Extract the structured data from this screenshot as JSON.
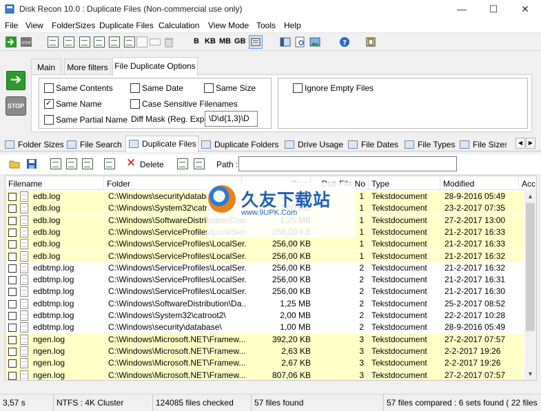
{
  "window": {
    "title": "Disk Recon 10.0 : Duplicate Files  (Non-commercial use only)",
    "controls": {
      "minimize": "—",
      "maximize": "☐",
      "close": "✕"
    }
  },
  "menu": [
    "File",
    "View",
    "FolderSizes",
    "Duplicate Files",
    "Calculation",
    "View Mode",
    "Tools",
    "Help"
  ],
  "toolbar": {
    "size_units": [
      "B",
      "KB",
      "MB",
      "GB"
    ],
    "icons": [
      "start-icon",
      "stop-icon",
      "export-excel-icon",
      "export-word-icon",
      "export-text-icon",
      "export-pdf-icon",
      "export-html-icon",
      "export-csv-icon",
      "copy-icon",
      "drive-icon",
      "recycle-bin-icon",
      "list-view-icon",
      "layout-icon",
      "find-icon",
      "image-icon",
      "help-icon",
      "info-icon"
    ]
  },
  "options": {
    "go_label": "➔",
    "stop_label": "STOP",
    "tabs": [
      "Main",
      "More filters",
      "File Duplicate Options"
    ],
    "active_tab": "File Duplicate Options",
    "checkboxes": {
      "same_contents": "Same Contents",
      "same_date": "Same Date",
      "same_size": "Same Size",
      "same_name": "Same Name",
      "case_sensitive": "Case Sensitive Filenames",
      "same_partial_name": "Same Partial Name",
      "ignore_empty": "Ignore Empty Files"
    },
    "checked": [
      "same_name"
    ],
    "diff_mask_label": "Diff Mask (Reg. Exp.)",
    "diff_mask_value": "\\D\\d{1,3}\\D"
  },
  "main_tabs": [
    "Folder Sizes",
    "File Search",
    "Duplicate Files",
    "Duplicate Folders",
    "Drive Usage",
    "File Dates",
    "File Types",
    "File Sizes"
  ],
  "active_main_tab": "Duplicate Files",
  "tab_scroll": {
    "left": "◀",
    "right": "▶"
  },
  "file_toolbar": {
    "delete_label": "Delete",
    "path_label": "Path :",
    "path_value": ""
  },
  "list": {
    "columns": [
      "Filename",
      "Folder",
      "Size",
      "Dup File No",
      "Type",
      "Modified",
      "Acc"
    ],
    "rows": [
      {
        "name": "edb.log",
        "folder": "C:\\Windows\\security\\database\\",
        "size": "1,00 MB",
        "set": "1",
        "type": "Tekstdocument",
        "modified": "28-9-2016 05:49",
        "hl": true
      },
      {
        "name": "edb.log",
        "folder": "C:\\Windows\\System32\\catroot2\\",
        "size": "2,00 MB",
        "set": "1",
        "type": "Tekstdocument",
        "modified": "23-2-2017 07:35",
        "hl": true
      },
      {
        "name": "edb.log",
        "folder": "C:\\Windows\\SoftwareDistribution\\DataStore\\",
        "size": "1,25 MB",
        "set": "1",
        "type": "Tekstdocument",
        "modified": "27-2-2017 13:00",
        "hl": true
      },
      {
        "name": "edb.log",
        "folder": "C:\\Windows\\ServiceProfiles\\LocalService\\",
        "size": "256,00 KB",
        "set": "1",
        "type": "Tekstdocument",
        "modified": "21-2-2017 16:33",
        "hl": true
      },
      {
        "name": "edb.log",
        "folder": "C:\\Windows\\ServiceProfiles\\LocalSer...",
        "size": "256,00 KB",
        "set": "1",
        "type": "Tekstdocument",
        "modified": "21-2-2017 16:33",
        "hl": true
      },
      {
        "name": "edb.log",
        "folder": "C:\\Windows\\ServiceProfiles\\LocalSer...",
        "size": "256,00 KB",
        "set": "1",
        "type": "Tekstdocument",
        "modified": "21-2-2017 16:32",
        "hl": true
      },
      {
        "name": "edbtmp.log",
        "folder": "C:\\Windows\\ServiceProfiles\\LocalSer...",
        "size": "256,00 KB",
        "set": "2",
        "type": "Tekstdocument",
        "modified": "21-2-2017 16:32",
        "hl": false
      },
      {
        "name": "edbtmp.log",
        "folder": "C:\\Windows\\ServiceProfiles\\LocalSer...",
        "size": "256,00 KB",
        "set": "2",
        "type": "Tekstdocument",
        "modified": "21-2-2017 16:31",
        "hl": false
      },
      {
        "name": "edbtmp.log",
        "folder": "C:\\Windows\\ServiceProfiles\\LocalSer...",
        "size": "256,00 KB",
        "set": "2",
        "type": "Tekstdocument",
        "modified": "21-2-2017 16:30",
        "hl": false
      },
      {
        "name": "edbtmp.log",
        "folder": "C:\\Windows\\SoftwareDistribution\\Da...",
        "size": "1,25 MB",
        "set": "2",
        "type": "Tekstdocument",
        "modified": "25-2-2017 08:52",
        "hl": false
      },
      {
        "name": "edbtmp.log",
        "folder": "C:\\Windows\\System32\\catroot2\\",
        "size": "2,00 MB",
        "set": "2",
        "type": "Tekstdocument",
        "modified": "22-2-2017 10:28",
        "hl": false
      },
      {
        "name": "edbtmp.log",
        "folder": "C:\\Windows\\security\\database\\",
        "size": "1,00 MB",
        "set": "2",
        "type": "Tekstdocument",
        "modified": "28-9-2016 05:49",
        "hl": false
      },
      {
        "name": "ngen.log",
        "folder": "C:\\Windows\\Microsoft.NET\\Framew...",
        "size": "392,20 KB",
        "set": "3",
        "type": "Tekstdocument",
        "modified": "27-2-2017 07:57",
        "hl": true
      },
      {
        "name": "ngen.log",
        "folder": "C:\\Windows\\Microsoft.NET\\Framew...",
        "size": "2,63 KB",
        "set": "3",
        "type": "Tekstdocument",
        "modified": "2-2-2017 19:26",
        "hl": true
      },
      {
        "name": "ngen.log",
        "folder": "C:\\Windows\\Microsoft.NET\\Framew...",
        "size": "2,67 KB",
        "set": "3",
        "type": "Tekstdocument",
        "modified": "2-2-2017 19:26",
        "hl": true
      },
      {
        "name": "ngen.log",
        "folder": "C:\\Windows\\Microsoft.NET\\Framew...",
        "size": "807,06 KB",
        "set": "3",
        "type": "Tekstdocument",
        "modified": "27-2-2017 07:57",
        "hl": true
      }
    ]
  },
  "watermark": {
    "title": "久友下载站",
    "url": "www.9UPK.Com"
  },
  "status": {
    "time": "3,57 s",
    "fs": "NTFS : 4K Cluster",
    "checked": "124085 files checked",
    "found": "57 files found",
    "summary": "57 files compared : 6 sets found ( 22 files"
  },
  "colors": {
    "highlight_row": "#ffffc8",
    "go_green": "#2d9a2d",
    "delete_red": "#d01a1a",
    "watermark_blue": "#1f5fb8"
  }
}
